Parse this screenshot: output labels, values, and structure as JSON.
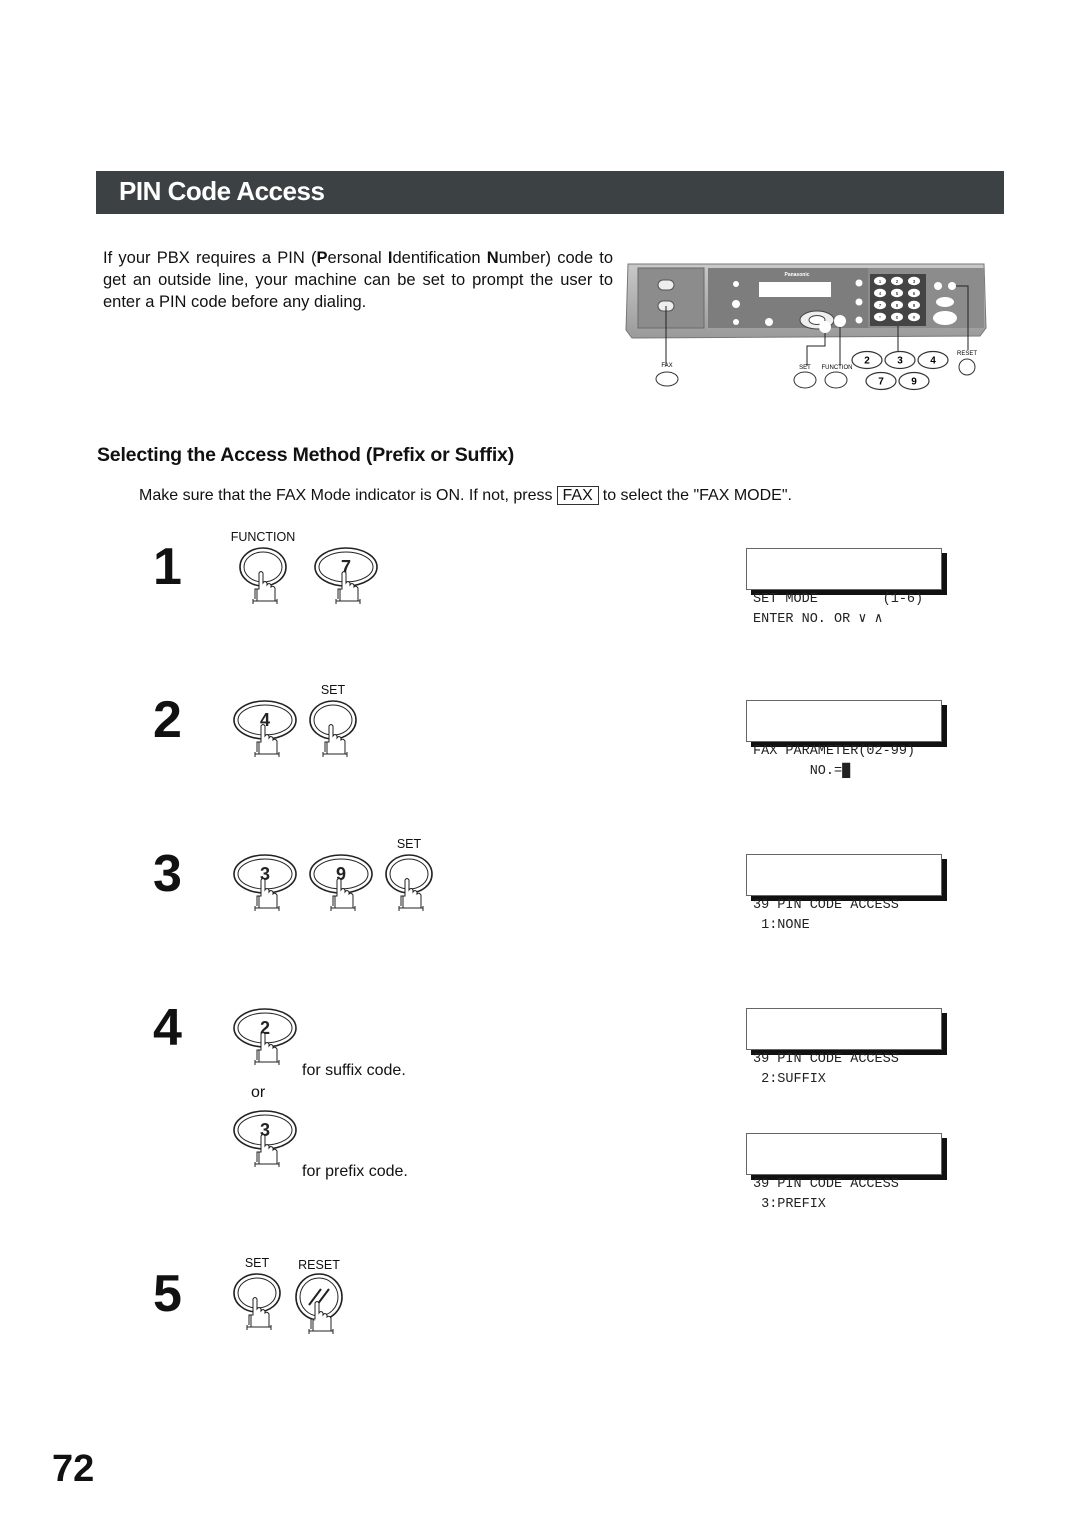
{
  "page": {
    "title": "PIN Code Access",
    "intro": {
      "before_p": "If your PBX requires a PIN (",
      "p": "P",
      "ersonal": "ersonal ",
      "i": "I",
      "dentification": "dentification ",
      "n": "N",
      "rest": "umber) code to get an outside line, your machine can be set to prompt the user to enter a PIN code before any dialing."
    },
    "panel_diagram": {
      "brand": "Panasonic",
      "callouts": {
        "fax": "FAX",
        "set": "SET",
        "function": "FUNCTION",
        "reset": "RESET",
        "keys": [
          "2",
          "3",
          "4",
          "7",
          "9"
        ]
      },
      "keypad": [
        "1",
        "2",
        "3",
        "4",
        "5",
        "6",
        "7",
        "8",
        "9",
        "*",
        "0",
        "#"
      ]
    },
    "subheading": "Selecting the Access Method (Prefix or Suffix)",
    "note": {
      "before": "Make sure that the FAX Mode indicator is ON.  If not, press",
      "key": "FAX",
      "after": "to select the \"FAX MODE\"."
    },
    "steps": [
      {
        "number": "1",
        "buttons": [
          {
            "label": "FUNCTION",
            "key": ""
          },
          {
            "label": "",
            "key": "7"
          }
        ],
        "lcd": [
          "SET MODE        (1-6)",
          "ENTER NO. OR ∨ ∧"
        ]
      },
      {
        "number": "2",
        "buttons": [
          {
            "label": "",
            "key": "4"
          },
          {
            "label": "SET",
            "key": ""
          }
        ],
        "lcd": [
          "FAX PARAMETER(02-99)",
          "       NO.=█"
        ]
      },
      {
        "number": "3",
        "buttons": [
          {
            "label": "",
            "key": "3"
          },
          {
            "label": "",
            "key": "9"
          },
          {
            "label": "SET",
            "key": ""
          }
        ],
        "lcd": [
          "39 PIN CODE ACCESS",
          " 1:NONE"
        ]
      },
      {
        "number": "4",
        "options": [
          {
            "key": "2",
            "caption": "for suffix code.",
            "lcd": [
              "39 PIN CODE ACCESS",
              " 2:SUFFIX"
            ]
          },
          {
            "key": "3",
            "caption": "for prefix code.",
            "lcd": [
              "39 PIN CODE ACCESS",
              " 3:PREFIX"
            ]
          }
        ],
        "or_label": "or"
      },
      {
        "number": "5",
        "buttons": [
          {
            "label": "SET",
            "key": ""
          },
          {
            "label": "RESET",
            "key": ""
          }
        ]
      }
    ],
    "page_number": "72"
  }
}
